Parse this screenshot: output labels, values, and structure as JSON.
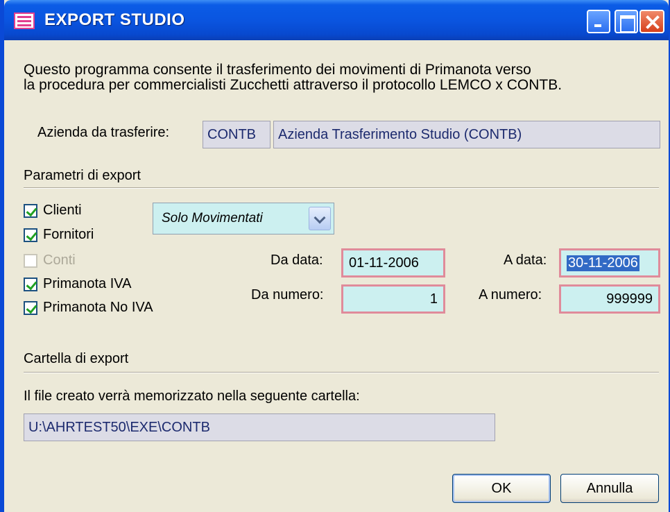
{
  "window": {
    "title": "EXPORT STUDIO"
  },
  "description": {
    "line1": "Questo programma consente il trasferimento dei movimenti di Primanota verso",
    "line2": "la procedura per commercialisti Zucchetti attraverso il protocollo LEMCO x CONTB."
  },
  "azienda": {
    "label": "Azienda da trasferire:",
    "code": "CONTB",
    "name": "Azienda Trasferimento Studio (CONTB)"
  },
  "parametri": {
    "section_title": "Parametri di export",
    "checkboxes": [
      {
        "label": "Clienti",
        "checked": true,
        "enabled": true
      },
      {
        "label": "Fornitori",
        "checked": true,
        "enabled": true
      },
      {
        "label": "Conti",
        "checked": false,
        "enabled": false
      },
      {
        "label": "Primanota IVA",
        "checked": true,
        "enabled": true
      },
      {
        "label": "Primanota No IVA",
        "checked": true,
        "enabled": true
      }
    ],
    "filter_select": {
      "value": "Solo Movimentati"
    },
    "da_data": {
      "label": "Da data:",
      "value": "01-11-2006"
    },
    "a_data": {
      "label": "A data:",
      "value": "30-11-2006"
    },
    "da_numero": {
      "label": "Da numero:",
      "value": "1"
    },
    "a_numero": {
      "label": "A numero:",
      "value": "999999"
    }
  },
  "cartella": {
    "section_title": "Cartella di export",
    "info": "Il file creato verrà memorizzato nella seguente cartella:",
    "path": "U:\\AHRTEST50\\EXE\\CONTB"
  },
  "buttons": {
    "ok": "OK",
    "cancel": "Annulla"
  },
  "colors": {
    "titlebar": "#0a55e0",
    "field_bg": "#ccf0f0",
    "field_border": "#e08b9a"
  }
}
